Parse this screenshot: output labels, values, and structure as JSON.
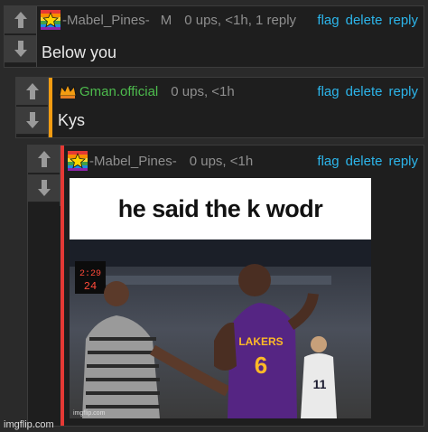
{
  "comments": [
    {
      "username": "-Mabel_Pines-",
      "gender": "M",
      "meta": "0 ups, <1h, 1 reply",
      "flag": "flag",
      "delete": "delete",
      "reply": "reply",
      "text": "Below you",
      "badge": "rainbow-star-badge"
    },
    {
      "username": "Gman.official",
      "meta": "0 ups, <1h",
      "flag": "flag",
      "delete": "delete",
      "reply": "reply",
      "text": "Kys",
      "badge": "crown-badge",
      "accent_color": "#f39c12"
    },
    {
      "username": "-Mabel_Pines-",
      "meta": "0 ups, <1h",
      "flag": "flag",
      "delete": "delete",
      "reply": "reply",
      "badge": "rainbow-star-badge",
      "accent_color": "#e53935",
      "meme": {
        "caption": "he said the k wodr",
        "watermark": "imgflip.com",
        "scoreboard_time": "2:29",
        "scoreboard_shot": "24",
        "jersey_left": "6",
        "jersey_team": "LAKERS",
        "jersey_right": "11"
      }
    }
  ],
  "site_watermark": "imgflip.com",
  "colors": {
    "link": "#2cb5ea",
    "mod_username": "#4dbb4d",
    "background": "#2a2a2a"
  }
}
